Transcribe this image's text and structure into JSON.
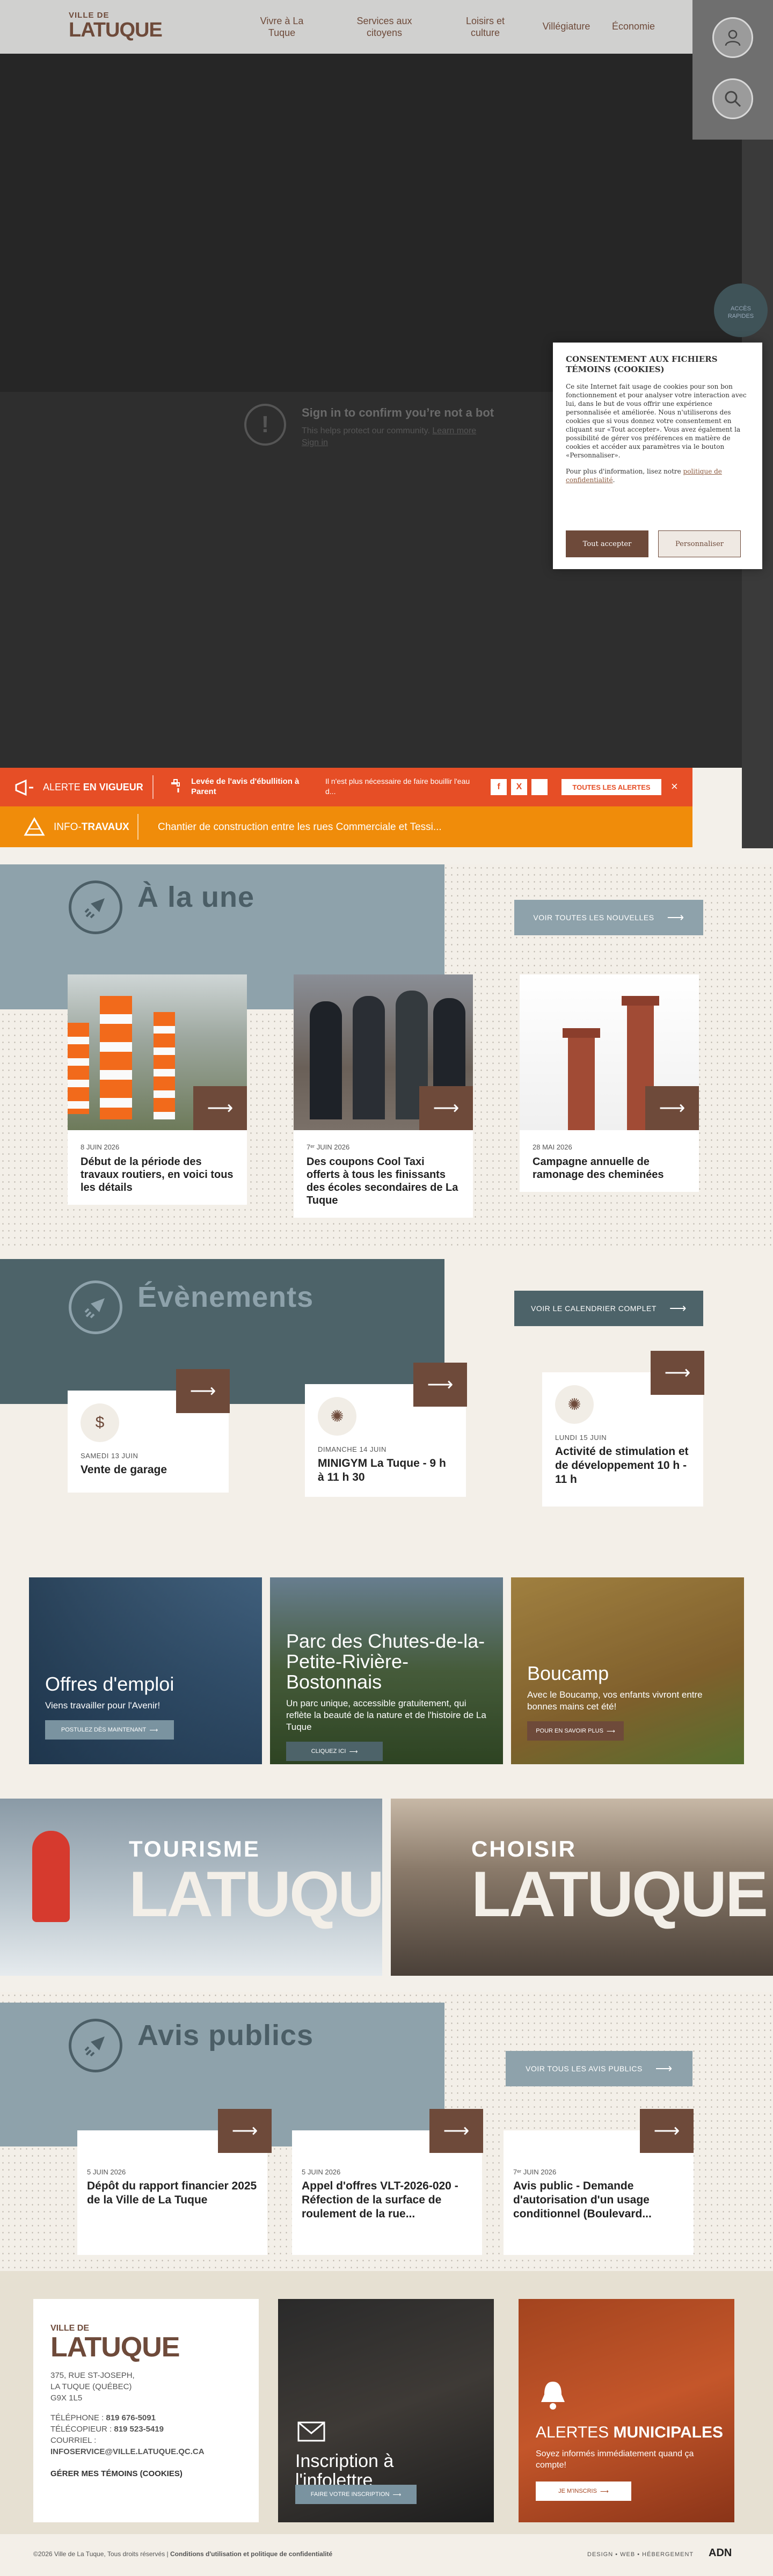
{
  "header": {
    "logo_small": "VILLE DE",
    "logo_big": "LATUQUE",
    "nav": [
      {
        "line1": "Vivre à La",
        "line2": "Tuque"
      },
      {
        "line1": "Services aux",
        "line2": "citoyens"
      },
      {
        "line1": "Loisirs et",
        "line2": "culture"
      },
      {
        "line1": "Villégiature",
        "line2": ""
      },
      {
        "line1": "Économie",
        "line2": ""
      }
    ]
  },
  "bot": {
    "icon": "!",
    "title": "Sign in to confirm you’re not a bot",
    "sub_prefix": "This helps protect our community. ",
    "learn_more": "Learn more",
    "sign_in": "Sign in"
  },
  "access": {
    "line1": "ACCÈS",
    "line2": "RAPIDES"
  },
  "cookie": {
    "title": "CONSENTEMENT AUX FICHIERS TÉMOINS (COOKIES)",
    "body": "Ce site Internet fait usage de cookies pour son bon fonctionnement et pour analyser votre interaction avec lui, dans le but de vous offrir une expérience personnalisée et améliorée. Nous n'utiliserons des cookies que si vous donnez votre consentement en cliquant sur «Tout accepter». Vous avez également la possibilité de gérer vos préférences en matière de cookies et accéder aux paramètres via le bouton «Personnaliser».",
    "more_prefix": "Pour plus d'information, lisez notre ",
    "more_link": "politique de confidentialité",
    "accept": "Tout accepter",
    "customize": "Personnaliser"
  },
  "alert": {
    "label_light": "ALERTE ",
    "label_bold": "EN VIGUEUR",
    "title": "Levée de l'avis d'ébullition à Parent",
    "desc": "Il n'est plus nécessaire de faire bouillir l'eau d...",
    "social": [
      "f",
      "X",
      ""
    ],
    "all_label": "TOUTES LES ALERTES",
    "close": "×"
  },
  "travaux": {
    "label_light": "INFO-",
    "label_bold": "TRAVAUX",
    "text": "Chantier de construction entre les rues Commerciale et Tessi..."
  },
  "une": {
    "title": "À la une",
    "all_label": "VOIR TOUTES LES NOUVELLES",
    "cards": [
      {
        "date": "8 JUIN 2026",
        "title": "Début de la période des travaux routiers, en voici tous les détails"
      },
      {
        "date": "7ᵉʳ JUIN 2026",
        "title": "Des coupons Cool Taxi offerts à tous les finissants des écoles secondaires de La Tuque"
      },
      {
        "date": "28 MAI 2026",
        "title": "Campagne annuelle de ramonage des cheminées"
      }
    ]
  },
  "events": {
    "title": "Évènements",
    "all_label": "VOIR LE CALENDRIER COMPLET",
    "cards": [
      {
        "icon": "$",
        "date": "SAMEDI 13 JUIN",
        "title": "Vente de garage"
      },
      {
        "icon": "✺",
        "date": "DIMANCHE 14 JUIN",
        "title": "MINIGYM La Tuque - 9 h à 11 h 30"
      },
      {
        "icon": "✺",
        "date": "LUNDI 15 JUIN",
        "title": "Activité de stimulation et de développement 10 h - 11 h"
      }
    ]
  },
  "promos": [
    {
      "title": "Offres d'emploi",
      "desc": "Viens travailler pour l'Avenir!",
      "button": "POSTULEZ DÈS MAINTENANT"
    },
    {
      "title": "Parc des Chutes-de-la-Petite-Rivière-Bostonnais",
      "desc": "Un parc unique, accessible gratuitement, qui reflète la beauté de la nature et de l'histoire de La Tuque",
      "button": "CLIQUEZ ICI"
    },
    {
      "title": "Boucamp",
      "desc": "Avec le Boucamp, vos enfants vivront entre bonnes mains cet été!",
      "button": "POUR EN SAVOIR PLUS"
    }
  ],
  "tourism": {
    "line1": "TOURISME",
    "line2": "LATUQUE"
  },
  "choisir": {
    "line1": "CHOISIR",
    "line2": "LATUQUE"
  },
  "avis": {
    "title": "Avis publics",
    "all_label": "VOIR TOUS LES AVIS PUBLICS",
    "cards": [
      {
        "date": "5 JUIN 2026",
        "title": "Dépôt du rapport financier 2025 de la Ville de La Tuque"
      },
      {
        "date": "5 JUIN 2026",
        "title": "Appel d'offres VLT-2026-020 - Réfection de la surface de roulement de la rue..."
      },
      {
        "date": "7ᵉʳ JUIN 2026",
        "title": "Avis public - Demande d'autorisation d'un usage conditionnel (Boulevard..."
      }
    ]
  },
  "footer": {
    "logo_small": "VILLE DE",
    "logo_big": "LATUQUE",
    "address1": "375, RUE ST-JOSEPH,",
    "address2": "LA TUQUE (QUÉBEC)",
    "address3": "G9X 1L5",
    "phone_label": "TÉLÉPHONE : ",
    "phone": "819 676-5091",
    "fax_label": "TÉLÉCOPIEUR : ",
    "fax": "819 523-5419",
    "email_label": "COURRIEL :",
    "email": "INFOSERVICE@VILLE.LATUQUE.QC.CA",
    "cookies_link": "GÉRER MES TÉMOINS (COOKIES)",
    "newsletter_title": "Inscription à l'infolettre",
    "newsletter_button": "FAIRE VOTRE INSCRIPTION",
    "alerts_light": "ALERTES ",
    "alerts_bold": "MUNICIPALES",
    "alerts_desc": "Soyez informés immédiatement quand ça compte!",
    "alerts_button": "JE M'INSCRIS",
    "copyright": "©2026 Ville de La Tuque, Tous droits réservés | ",
    "terms": "Conditions d'utilisation et politique de confidentialité",
    "credits": "DESIGN • WEB • HÉBERGEMENT",
    "agency": "ADN"
  },
  "colors": {
    "brown": "#6e4a3a",
    "slate": "#8ea2ab",
    "teal": "#3f5358",
    "alert_red": "#e64e26",
    "alert_orange": "#f08c0a"
  }
}
